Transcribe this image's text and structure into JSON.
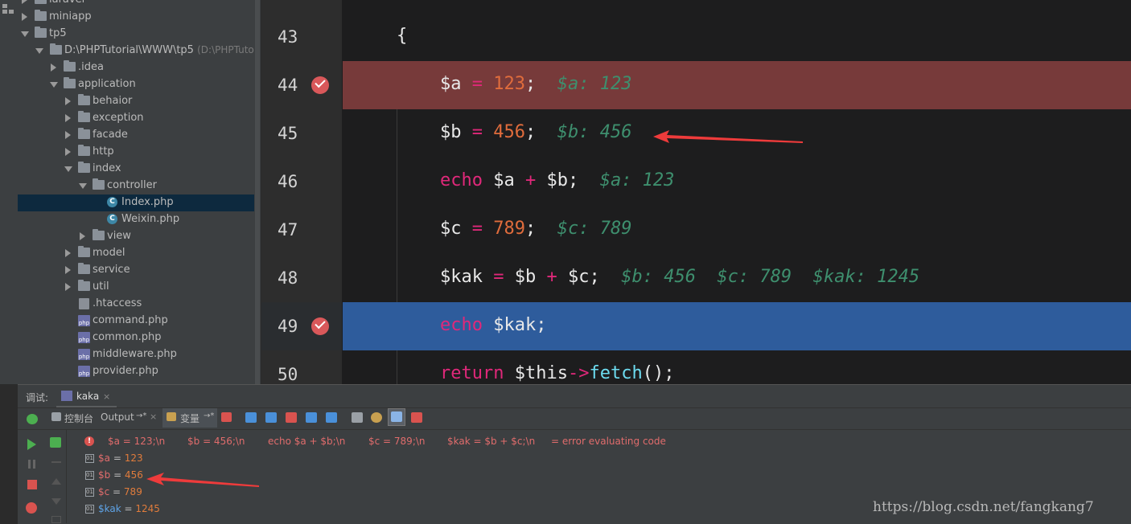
{
  "tree": {
    "items": [
      {
        "label": "laravel",
        "hint": ""
      },
      {
        "label": "miniapp",
        "hint": ""
      },
      {
        "label": "tp5",
        "hint": ""
      },
      {
        "label": "D:\\PHPTutorial\\WWW\\tp5",
        "hint": "(D:\\PHPTutorial\\"
      },
      {
        "label": ".idea",
        "hint": ""
      },
      {
        "label": "application",
        "hint": ""
      },
      {
        "label": "behaior",
        "hint": ""
      },
      {
        "label": "exception",
        "hint": ""
      },
      {
        "label": "facade",
        "hint": ""
      },
      {
        "label": "http",
        "hint": ""
      },
      {
        "label": "index",
        "hint": ""
      },
      {
        "label": "controller",
        "hint": ""
      },
      {
        "label": "Index.php",
        "hint": ""
      },
      {
        "label": "Weixin.php",
        "hint": ""
      },
      {
        "label": "view",
        "hint": ""
      },
      {
        "label": "model",
        "hint": ""
      },
      {
        "label": "service",
        "hint": ""
      },
      {
        "label": "util",
        "hint": ""
      },
      {
        "label": ".htaccess",
        "hint": ""
      },
      {
        "label": "command.php",
        "hint": ""
      },
      {
        "label": "common.php",
        "hint": ""
      },
      {
        "label": "middleware.php",
        "hint": ""
      },
      {
        "label": "provider.php",
        "hint": ""
      }
    ]
  },
  "editor": {
    "lines": [
      {
        "num": "43"
      },
      {
        "num": "44"
      },
      {
        "num": "45"
      },
      {
        "num": "46"
      },
      {
        "num": "47"
      },
      {
        "num": "48"
      },
      {
        "num": "49"
      },
      {
        "num": "50"
      }
    ],
    "code": {
      "l43": "{",
      "l44_var": "$a",
      "l44_eq": " = ",
      "l44_num": "123",
      "l44_end": ";",
      "l44_hint": "$a: 123",
      "l45_var": "$b",
      "l45_eq": " = ",
      "l45_num": "456",
      "l45_end": ";",
      "l45_hint": "$b: 456",
      "l46_kw": "echo",
      "l46_rest1": " $a ",
      "l46_op": "+",
      "l46_rest2": " $b;",
      "l46_hint": "$a: 123",
      "l47_var": "$c",
      "l47_eq": " = ",
      "l47_num": "789",
      "l47_end": ";",
      "l47_hint": "$c: 789",
      "l48_var": "$kak",
      "l48_eq": " = ",
      "l48_a": "$b ",
      "l48_op": "+",
      "l48_b": " $c;",
      "l48_hint": "$b: 456  $c: 789  $kak: 1245",
      "l49_kw": "echo",
      "l49_rest": " $kak;",
      "l50_kw": "return",
      "l50_this": " $this",
      "l50_arrow": "->",
      "l50_fn": "fetch",
      "l50_end": "();"
    }
  },
  "debug": {
    "title": "调试:",
    "tab": "kaka",
    "tab_close": "×",
    "toolbar": {
      "console": "控制台",
      "output": "Output",
      "output_pin": "→*",
      "output_close": "×",
      "variables": "变量",
      "variables_pin": "→*"
    },
    "error_row": {
      "parts": [
        "$a = 123;\\n",
        "$b = 456;\\n",
        "echo $a + $b;\\n",
        "$c = 789;\\n",
        "$kak = $b + $c;\\n",
        "= error evaluating code"
      ]
    },
    "vars": [
      {
        "name": "$a",
        "eq": " = ",
        "value": "123"
      },
      {
        "name": "$b",
        "eq": " = ",
        "value": "456"
      },
      {
        "name": "$c",
        "eq": " = ",
        "value": "789"
      },
      {
        "name": "$kak",
        "eq": " = ",
        "value": "1245"
      }
    ]
  },
  "watermark": "https://blog.csdn.net/fangkang7",
  "colors": {
    "breakpoint_line": "#773a3a",
    "exec_line": "#2e5c9c",
    "arrow": "#ee3b3b"
  }
}
